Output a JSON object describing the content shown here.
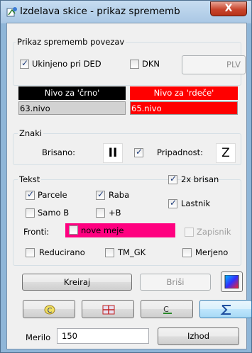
{
  "window": {
    "title": "Izdelava skice - prikaz sprememb",
    "close_glyph": "X"
  },
  "povezav": {
    "label": "Prikaz sprememb povezav",
    "ukinjeno_label": "Ukinjeno pri DED",
    "ukinjeno_checked": true,
    "dkn_label": "DKN",
    "dkn_checked": false,
    "plv_label": "PLV"
  },
  "nivo": {
    "crno_header": "Nivo za 'črno'",
    "crno_value": "63.nivo",
    "rdece_header": "Nivo za 'rdeče'",
    "rdece_value": "65.nivo",
    "rdece_color": "#ff0000"
  },
  "znaki": {
    "label": "Znaki",
    "brisano_label": "Brisano:",
    "brisano_symbol": "II",
    "pripadnost_label": "Pripadnost:",
    "pripadnost_checked": true,
    "pripadnost_symbol": "Z"
  },
  "tekst": {
    "label": "Tekst",
    "brisan2x_label": "2x brisan",
    "brisan2x_checked": true,
    "parcele_label": "Parcele",
    "parcele_checked": true,
    "raba_label": "Raba",
    "raba_checked": true,
    "lastnik_label": "Lastnik",
    "lastnik_checked": true,
    "samob_label": "Samo B",
    "samob_checked": false,
    "plusb_label": "+B",
    "plusb_checked": false,
    "fronti_label": "Fronti:",
    "nove_meje_label": "nove meje",
    "nove_meje_checked": false,
    "nove_meje_color": "#ff0080",
    "zapisnik_label": "Zapisnik",
    "reducirano_label": "Reducirano",
    "tmgk_label": "TM_GK",
    "merjeno_label": "Merjeno"
  },
  "buttons": {
    "kreiraj": "Kreiraj",
    "brisi": "Briši",
    "izhod": "Izhod"
  },
  "merilo": {
    "label": "Merilo",
    "value": "150"
  }
}
